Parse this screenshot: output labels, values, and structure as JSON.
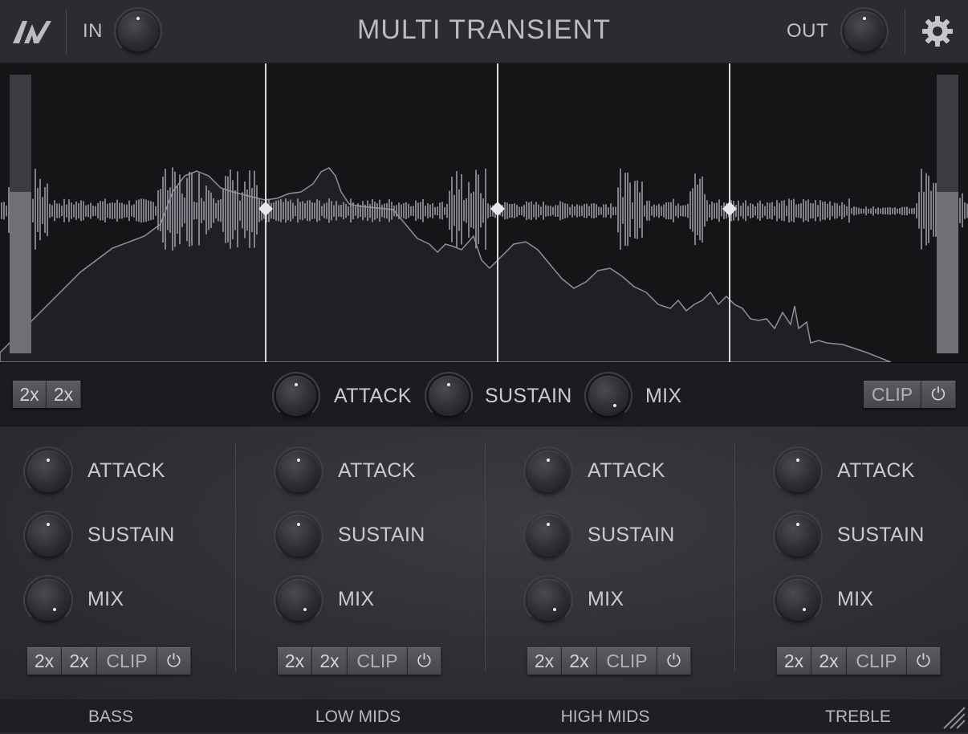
{
  "header": {
    "logo": "AV",
    "in_label": "IN",
    "title": "MULTI TRANSIENT",
    "out_label": "OUT",
    "settings_icon": "gear-icon"
  },
  "master": {
    "oversample_1": "2x",
    "oversample_2": "2x",
    "attack_label": "ATTACK",
    "sustain_label": "SUSTAIN",
    "mix_label": "MIX",
    "clip_label": "CLIP",
    "power_icon": "power-icon"
  },
  "bands": [
    {
      "name": "BASS",
      "attack": "ATTACK",
      "sustain": "SUSTAIN",
      "mix": "MIX",
      "os1": "2x",
      "os2": "2x",
      "clip": "CLIP"
    },
    {
      "name": "LOW MIDS",
      "attack": "ATTACK",
      "sustain": "SUSTAIN",
      "mix": "MIX",
      "os1": "2x",
      "os2": "2x",
      "clip": "CLIP"
    },
    {
      "name": "HIGH MIDS",
      "attack": "ATTACK",
      "sustain": "SUSTAIN",
      "mix": "MIX",
      "os1": "2x",
      "os2": "2x",
      "clip": "CLIP"
    },
    {
      "name": "TREBLE",
      "attack": "ATTACK",
      "sustain": "SUSTAIN",
      "mix": "MIX",
      "os1": "2x",
      "os2": "2x",
      "clip": "CLIP"
    }
  ],
  "colors": {
    "background": "#2a2b2f",
    "display": "#151517",
    "waveform": "#9a9ca3",
    "text": "#c8cacf"
  }
}
